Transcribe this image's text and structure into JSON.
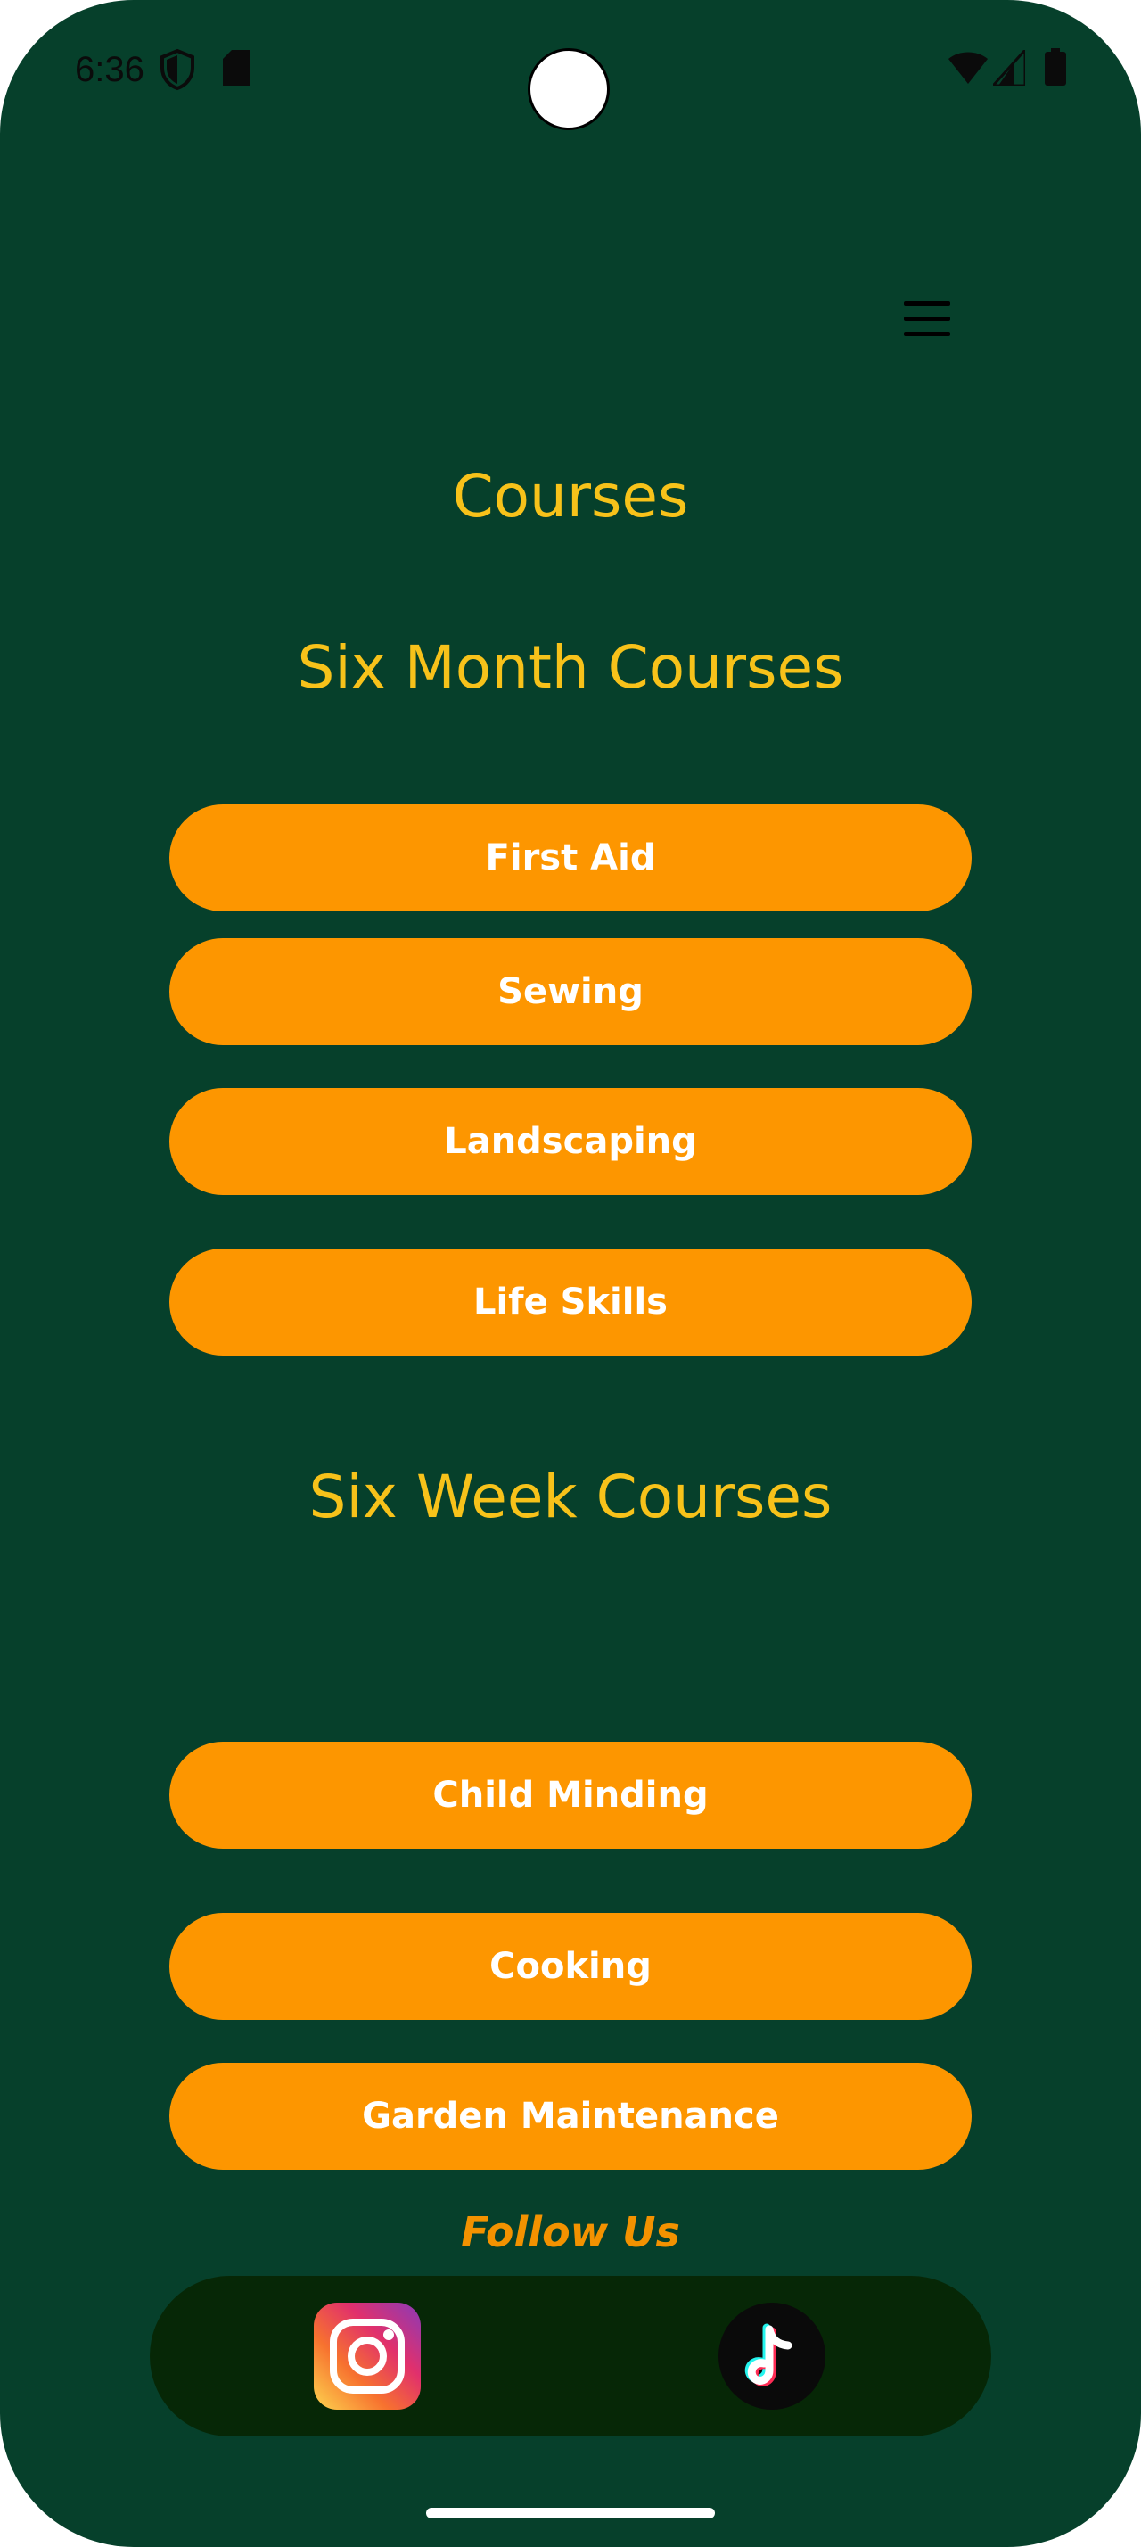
{
  "status_bar": {
    "time": "6:36"
  },
  "header": {
    "menu_icon": "hamburger-menu-icon"
  },
  "page": {
    "title": "Courses"
  },
  "sections": {
    "six_month": {
      "title": "Six Month Courses",
      "courses": [
        "First Aid",
        "Sewing",
        "Landscaping",
        "Life Skills"
      ]
    },
    "six_week": {
      "title": "Six Week Courses",
      "courses": [
        "Child Minding",
        "Cooking",
        "Garden Maintenance"
      ]
    }
  },
  "footer": {
    "follow_label": "Follow Us",
    "social": [
      "instagram-icon",
      "tiktok-icon"
    ]
  },
  "colors": {
    "background": "#06402b",
    "heading": "#f7c21a",
    "button": "#fd9600",
    "button_text": "#ffffff",
    "follow_text": "#f39200",
    "social_bar": "#062706"
  }
}
